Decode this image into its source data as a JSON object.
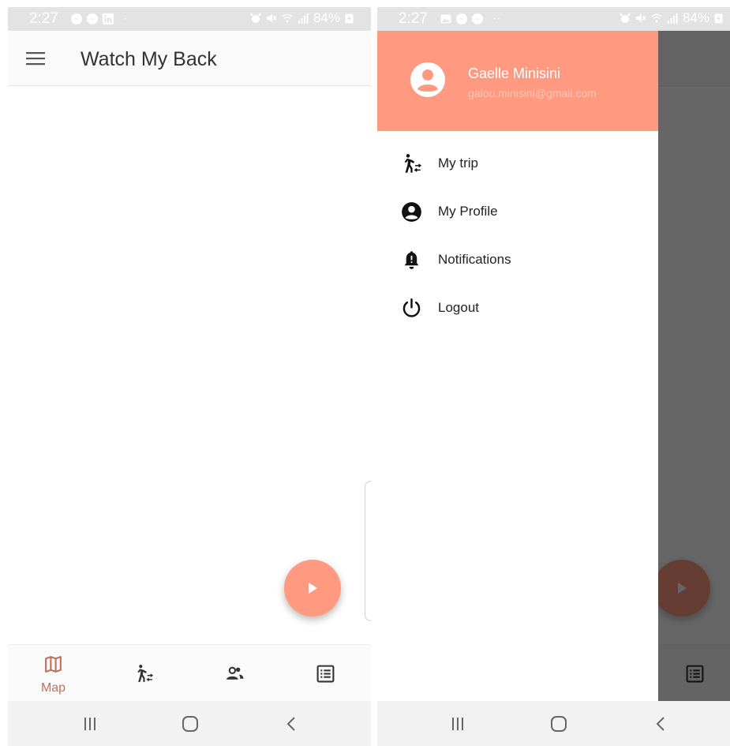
{
  "colors": {
    "accent": "#ff9a80",
    "nav_active": "#c2705a",
    "icon_dark": "#222222",
    "status_bar": "#e3e3e3",
    "scrim": "rgba(0,0,0,0.6)"
  },
  "left_screen": {
    "status_bar": {
      "time": "2:27",
      "battery": "84%",
      "icons": [
        "messenger-icon",
        "messenger-icon",
        "linkedin-icon",
        "dot"
      ]
    },
    "app_bar": {
      "title": "Watch My Back",
      "menu_icon": "hamburger-menu-icon"
    },
    "fab": {
      "icon": "play-icon"
    },
    "bottom_nav": {
      "items": [
        {
          "label": "Map",
          "icon": "map-icon",
          "active": true
        },
        {
          "label": "",
          "icon": "hiker-swap-icon",
          "active": false
        },
        {
          "label": "",
          "icon": "people-icon",
          "active": false
        },
        {
          "label": "",
          "icon": "list-icon",
          "active": false
        }
      ]
    }
  },
  "right_screen": {
    "status_bar": {
      "time": "2:27",
      "battery": "84%",
      "icons": [
        "gallery-icon",
        "messenger-icon",
        "messenger-icon",
        "dots"
      ]
    },
    "drawer": {
      "user_name": "Gaelle Minisini",
      "user_email": "galou.minisini@gmail.com",
      "items": [
        {
          "label": "My trip",
          "icon": "hiker-swap-icon"
        },
        {
          "label": "My Profile",
          "icon": "account-circle-icon"
        },
        {
          "label": "Notifications",
          "icon": "bell-icon"
        },
        {
          "label": "Logout",
          "icon": "power-icon"
        }
      ]
    }
  }
}
